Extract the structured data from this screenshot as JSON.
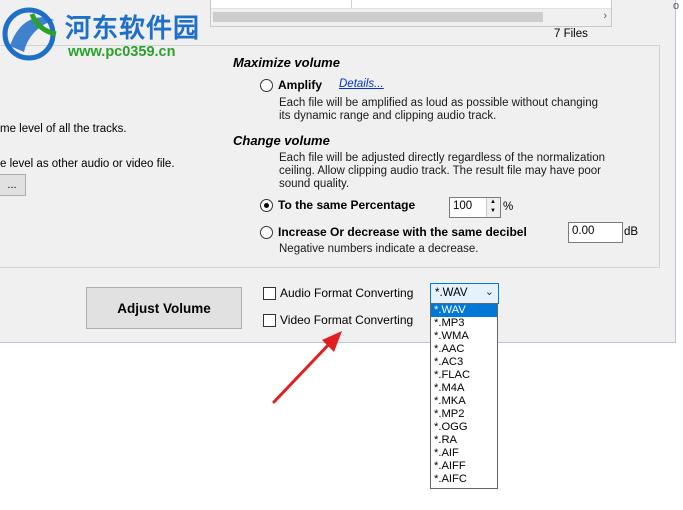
{
  "list": {
    "file_count": "7 Files"
  },
  "edge_glyph": "o",
  "watermark": {
    "title": "河东软件园",
    "url": "www.pc0359.cn"
  },
  "left_clipped": {
    "line1": "me level of all the tracks.",
    "line2": "e level as other audio or video file.",
    "browse_label": "..."
  },
  "maximize": {
    "heading": "Maximize volume",
    "amplify_label": "Amplify",
    "details_link": "Details...",
    "amplify_desc_1": "Each file will be amplified as loud as possible without changing",
    "amplify_desc_2": "its dynamic range and clipping audio track."
  },
  "change": {
    "heading": "Change volume",
    "desc_1": "Each file will be adjusted directly regardless of the normalization",
    "desc_2": "ceiling. Allow clipping audio track. The result file may have poor",
    "desc_3": "sound quality.",
    "percentage_label": "To the same Percentage",
    "percentage_value": "100",
    "percentage_unit": "%",
    "decibel_label": "Increase Or decrease with the same decibel",
    "decibel_value": "0.00",
    "decibel_unit": "dB",
    "negative_note": "Negative numbers indicate a decrease."
  },
  "bottom": {
    "adjust_button": "Adjust Volume",
    "audio_format_label": "Audio Format Converting",
    "video_format_label": "Video Format Converting",
    "format_selected": "*.WAV"
  },
  "format_options": [
    "*.WAV",
    "*.MP3",
    "*.WMA",
    "*.AAC",
    "*.AC3",
    "*.FLAC",
    "*.M4A",
    "*.MKA",
    "*.MP2",
    "*.OGG",
    "*.RA",
    "*.AIF",
    "*.AIFF",
    "*.AIFC"
  ],
  "colors": {
    "accent": "#0078d7",
    "link": "#0033cc",
    "arrow": "#e02020",
    "watermark_blue": "#1e6fc8",
    "watermark_green": "#2aa12a"
  }
}
